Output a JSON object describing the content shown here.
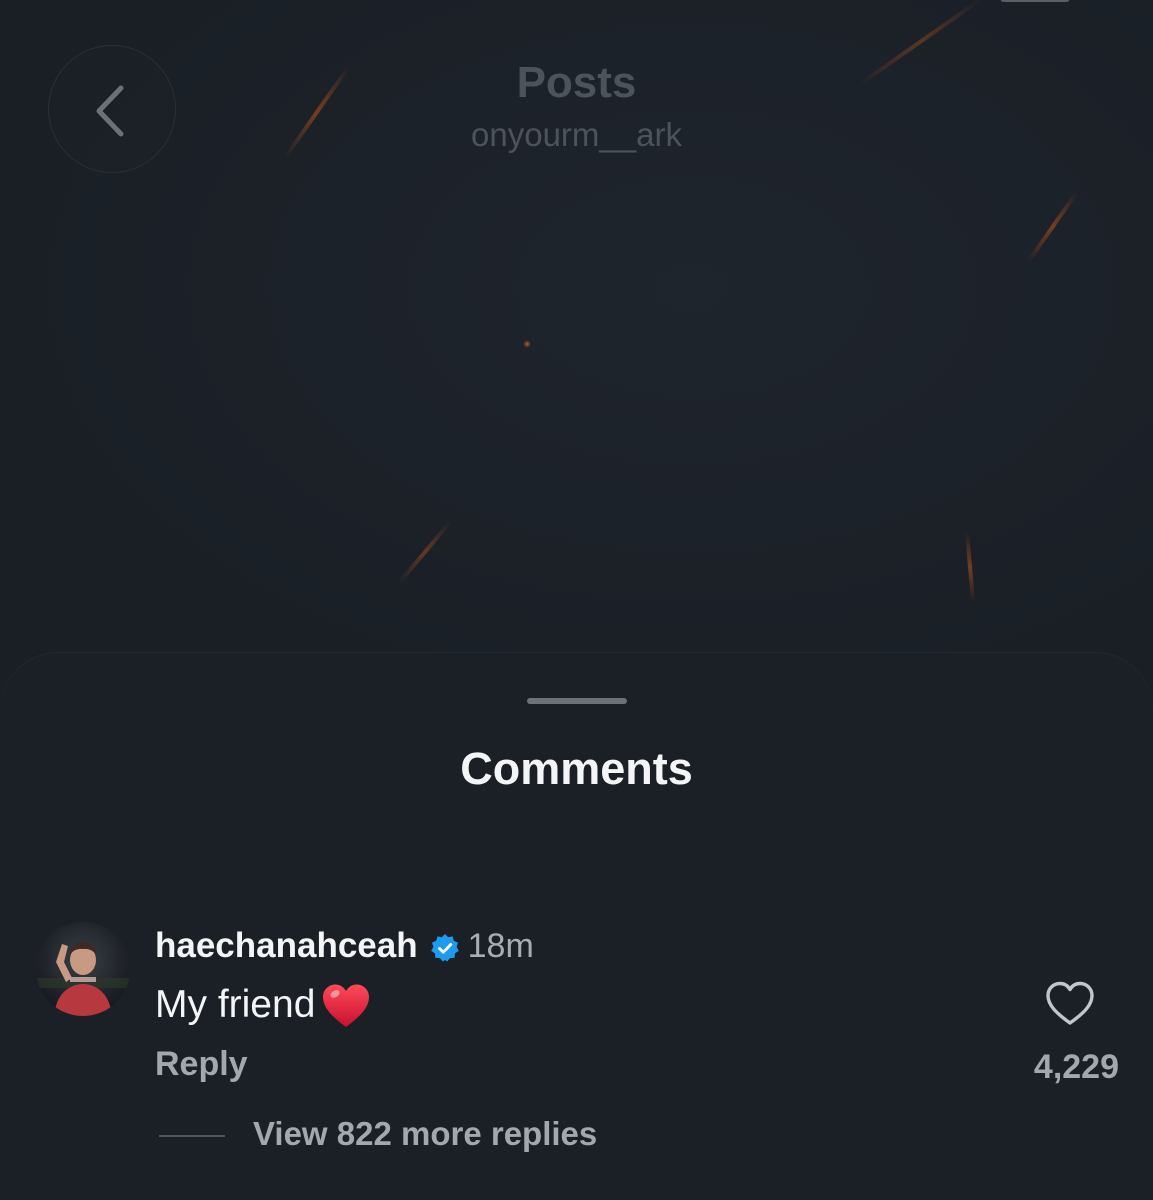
{
  "header": {
    "title": "Posts",
    "subtitle": "onyourm__ark",
    "back_icon": "chevron-left-icon"
  },
  "sheet": {
    "title": "Comments"
  },
  "comment": {
    "username": "haechanahceah",
    "verified": true,
    "time": "18m",
    "text": "My friend",
    "emoji": "red-heart",
    "reply_label": "Reply",
    "like_count": "4,229",
    "view_replies_label": "View 822 more replies"
  },
  "colors": {
    "background": "#1b2027",
    "verified_badge": "#1d9bf0",
    "primary_text": "#f3f5f7",
    "secondary_text": "#a3a8ae",
    "heart_emoji": "#e0142b"
  }
}
